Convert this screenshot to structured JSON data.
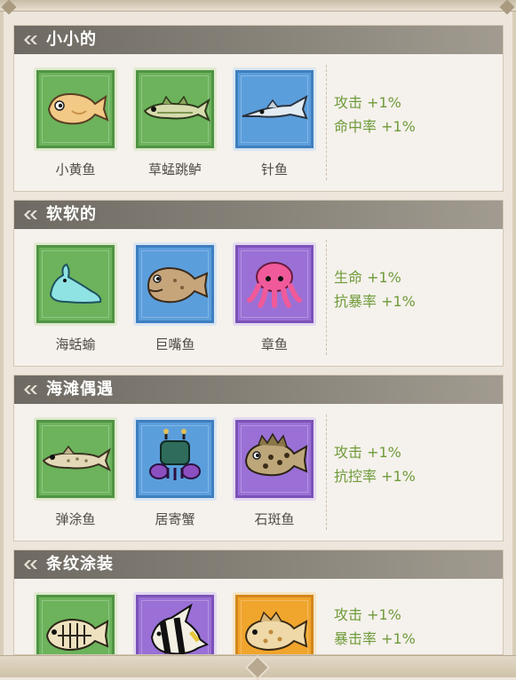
{
  "collections": [
    {
      "title": "小小的",
      "items": [
        {
          "name": "小黄鱼",
          "rarity": "green",
          "icon": "yellow-croaker-icon"
        },
        {
          "name": "草蜢跳鲈",
          "rarity": "green",
          "icon": "grasshopper-perch-icon"
        },
        {
          "name": "针鱼",
          "rarity": "blue",
          "icon": "needlefish-icon"
        }
      ],
      "bonuses": [
        "攻击 +1%",
        "命中率 +1%"
      ]
    },
    {
      "title": "软软的",
      "items": [
        {
          "name": "海蛞蝓",
          "rarity": "green",
          "icon": "sea-slug-icon"
        },
        {
          "name": "巨嘴鱼",
          "rarity": "blue",
          "icon": "bigmouth-fish-icon"
        },
        {
          "name": "章鱼",
          "rarity": "purple",
          "icon": "octopus-icon"
        }
      ],
      "bonuses": [
        "生命 +1%",
        "抗暴率 +1%"
      ]
    },
    {
      "title": "海滩偶遇",
      "items": [
        {
          "name": "弹涂鱼",
          "rarity": "green",
          "icon": "mudskipper-icon"
        },
        {
          "name": "居寄蟹",
          "rarity": "blue",
          "icon": "hermit-crab-icon"
        },
        {
          "name": "石斑鱼",
          "rarity": "purple",
          "icon": "grouper-icon"
        }
      ],
      "bonuses": [
        "攻击 +1%",
        "抗控率 +1%"
      ]
    },
    {
      "title": "条纹涂装",
      "items": [
        {
          "name": "",
          "rarity": "green",
          "icon": "skeleton-fish-icon"
        },
        {
          "name": "",
          "rarity": "purple",
          "icon": "moorish-idol-icon"
        },
        {
          "name": "",
          "rarity": "orange",
          "icon": "spotted-fish-icon"
        }
      ],
      "bonuses": [
        "攻击 +1%",
        "暴击率 +1%"
      ]
    }
  ],
  "colors": {
    "green": "#6cb35c",
    "blue": "#5b9edc",
    "purple": "#9a70d6",
    "orange": "#f0a52d",
    "bonus_text": "#6f9b3a",
    "header": "#7a766e"
  }
}
